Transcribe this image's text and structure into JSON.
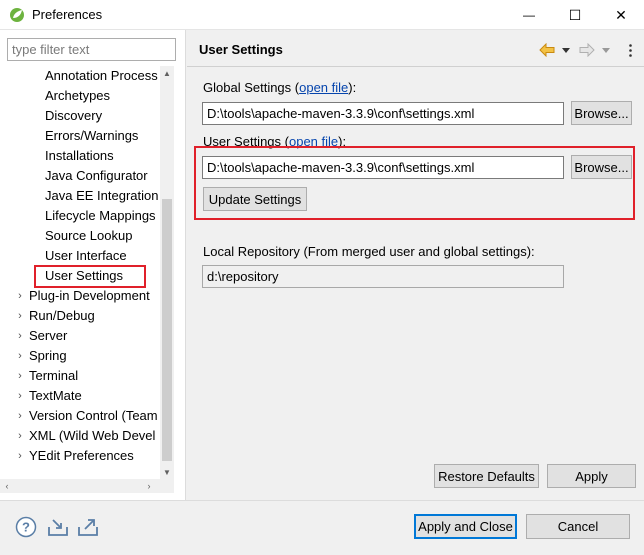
{
  "window": {
    "title": "Preferences",
    "minimize_glyph": "—",
    "maximize_glyph": "☐",
    "close_glyph": "✕"
  },
  "filter": {
    "placeholder": "type filter text"
  },
  "tree": {
    "children": [
      "Annotation Process",
      "Archetypes",
      "Discovery",
      "Errors/Warnings",
      "Installations",
      "Java Configurator",
      "Java EE Integration",
      "Lifecycle Mappings",
      "Source Lookup",
      "User Interface",
      "User Settings"
    ],
    "selected": "User Settings",
    "top_items": [
      "Plug-in Development",
      "Run/Debug",
      "Server",
      "Spring",
      "Terminal",
      "TextMate",
      "Version Control (Team",
      "XML (Wild Web Devel",
      "YEdit Preferences"
    ],
    "expand_glyph": "›"
  },
  "page": {
    "title": "User Settings",
    "global_label_prefix": "Global Settings (",
    "global_link": "open file",
    "global_label_suffix": "):",
    "global_path": "D:\\tools\\apache-maven-3.3.9\\conf\\settings.xml",
    "browse_label": "Browse...",
    "user_label_prefix": "User Settings (",
    "user_link": "open file",
    "user_label_suffix": "):",
    "user_path": "D:\\tools\\apache-maven-3.3.9\\conf\\settings.xml",
    "update_label": "Update Settings",
    "local_repo_label": "Local Repository (From merged user and global settings):",
    "local_repo_value": "d:\\repository",
    "restore_label": "Restore Defaults",
    "apply_label": "Apply"
  },
  "footer": {
    "apply_close_label": "Apply and Close",
    "cancel_label": "Cancel"
  },
  "colors": {
    "highlight": "#e0202a",
    "accent": "#0078d7",
    "link": "#0645ad",
    "nav_back": "#e8a21a"
  }
}
